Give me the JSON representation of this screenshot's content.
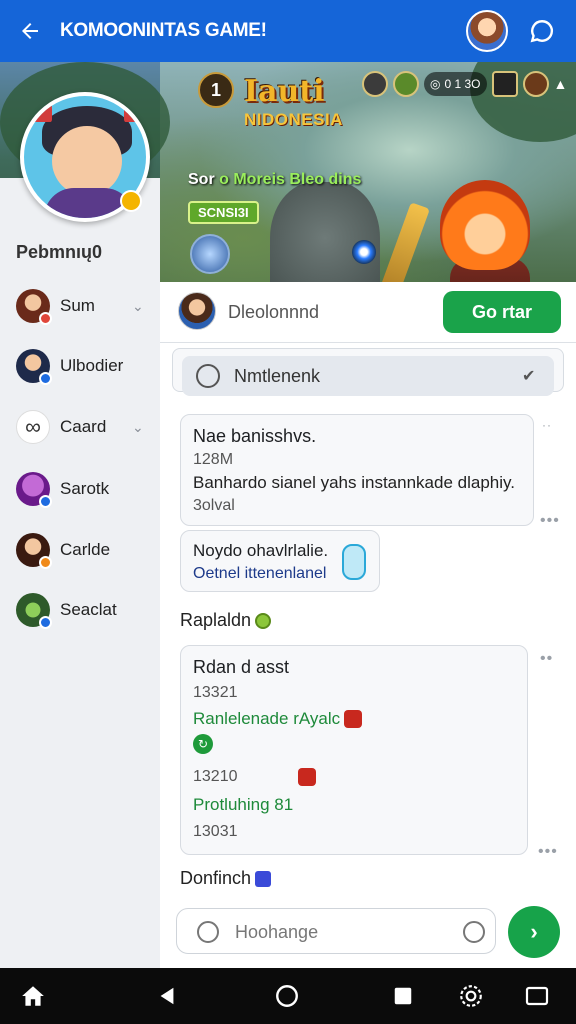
{
  "app": {
    "title": "KOMOONINTAS GAME!"
  },
  "banner": {
    "logo_title": "Iauti",
    "logo_subtitle": "NIDONESIA",
    "rank": "1",
    "coins": "0 1 3O",
    "tagline_prefix": "Sor",
    "tagline_highlight": "o Moreis Bleo dins",
    "badge": "SCNSI3I"
  },
  "sidebar": {
    "heading": "Pebmnıų0",
    "items": [
      {
        "label": "Sum",
        "has_chevron": true
      },
      {
        "label": "Ulbodier",
        "has_chevron": false
      },
      {
        "label": "Caard",
        "has_chevron": true
      },
      {
        "label": "Sarotk",
        "has_chevron": false
      },
      {
        "label": "Carlde",
        "has_chevron": false
      },
      {
        "label": "Seaclat",
        "has_chevron": false
      }
    ]
  },
  "post": {
    "placeholder": "Dleolonnnd",
    "go_label": "Go rtar"
  },
  "filter": {
    "label": "Nmtlenenk"
  },
  "feed": {
    "card1": {
      "title": "Nae banisshvs.",
      "num": "128M",
      "body": "Banhardo sianel yahs instannkade dlaphiy.",
      "meta": "3olval"
    },
    "card2": {
      "title": "Noydo ohavlrlalie.",
      "green": "Oetnel ittenenlanel"
    },
    "section1": "Raplaldn",
    "card3": {
      "title": "Rdan d asst",
      "num1": "13321",
      "green1": "Ranlelenade rAyalc",
      "num2": "13210",
      "green2": "Protluhing",
      "green2_suffix": "81",
      "num3": "13031"
    },
    "section2": "Donfinch"
  },
  "composer": {
    "placeholder": "Hoohange",
    "send_label": "›"
  },
  "colors": {
    "primary": "#1565d8",
    "accent_green": "#1aa34a",
    "text_green": "#1e8a3a"
  }
}
